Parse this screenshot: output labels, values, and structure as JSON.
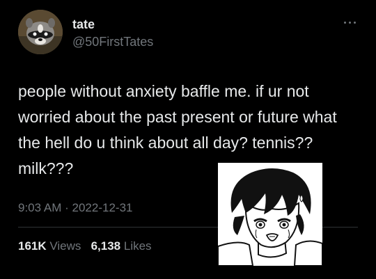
{
  "author": {
    "display_name": "tate",
    "handle": "@50FirstTates",
    "avatar_icon": "raccoon-avatar"
  },
  "tweet": {
    "text": "people without anxiety baffle me. if ur not worried about the past present or future what the hell do u think about all day? tennis?? milk???",
    "time": "9:03 AM",
    "separator": "·",
    "date": "2022-12-31"
  },
  "stats": {
    "views_count": "161K",
    "views_label": "Views",
    "likes_count": "6,138",
    "likes_label": "Likes"
  },
  "attached_image": {
    "icon": "anxious-manga-character-image"
  },
  "colors": {
    "background": "#000000",
    "primary_text": "#e7e9ea",
    "secondary_text": "#71767b",
    "divider": "#2f3336"
  }
}
